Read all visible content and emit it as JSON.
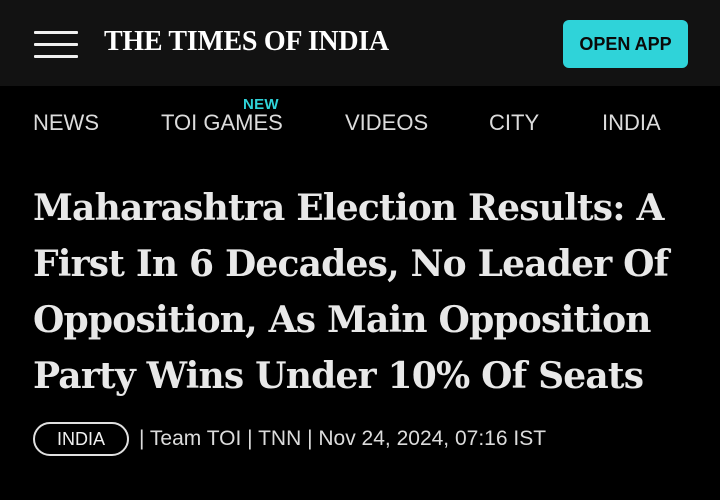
{
  "header": {
    "logo_text": "THE TIMES OF INDIA",
    "open_app_label": "OPEN APP",
    "accent_color": "#2fd3d9",
    "menu_icon": "hamburger-menu-icon"
  },
  "nav": {
    "items": [
      {
        "label": "NEWS"
      },
      {
        "label": "TOI GAMES",
        "badge": "NEW"
      },
      {
        "label": "VIDEOS"
      },
      {
        "label": "CITY"
      },
      {
        "label": "INDIA"
      }
    ]
  },
  "article": {
    "headline": "Maharashtra Election Results: A First In 6 Decades, No Leader Of Opposition, As Main Opposition Party Wins Under 10% Of Seats",
    "category": "INDIA",
    "byline": "| Team TOI | TNN | Nov 24, 2024, 07:16 IST"
  }
}
